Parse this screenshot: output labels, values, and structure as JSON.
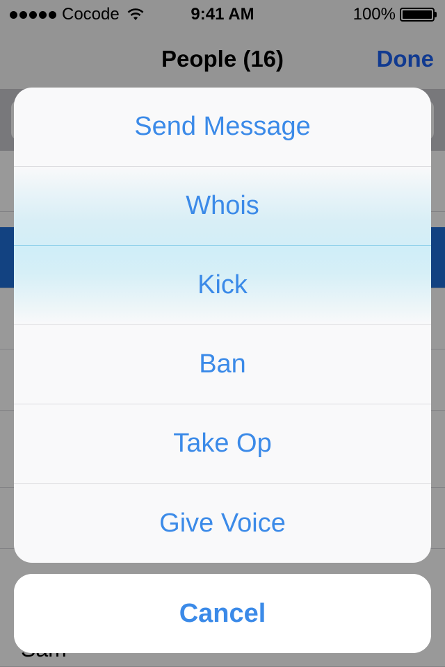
{
  "status_bar": {
    "carrier": "Cocode",
    "time": "9:41 AM",
    "battery": "100%"
  },
  "nav": {
    "title": "People (16)",
    "done_label": "Done"
  },
  "list": {
    "visible_name": "Sam"
  },
  "action_sheet": {
    "actions": [
      {
        "label": "Send Message"
      },
      {
        "label": "Whois"
      },
      {
        "label": "Kick"
      },
      {
        "label": "Ban"
      },
      {
        "label": "Take Op"
      },
      {
        "label": "Give Voice"
      }
    ],
    "cancel_label": "Cancel"
  },
  "colors": {
    "accent": "#3b8ae8",
    "nav_accent": "#1d62f0",
    "selection": "#1f6fd8"
  }
}
